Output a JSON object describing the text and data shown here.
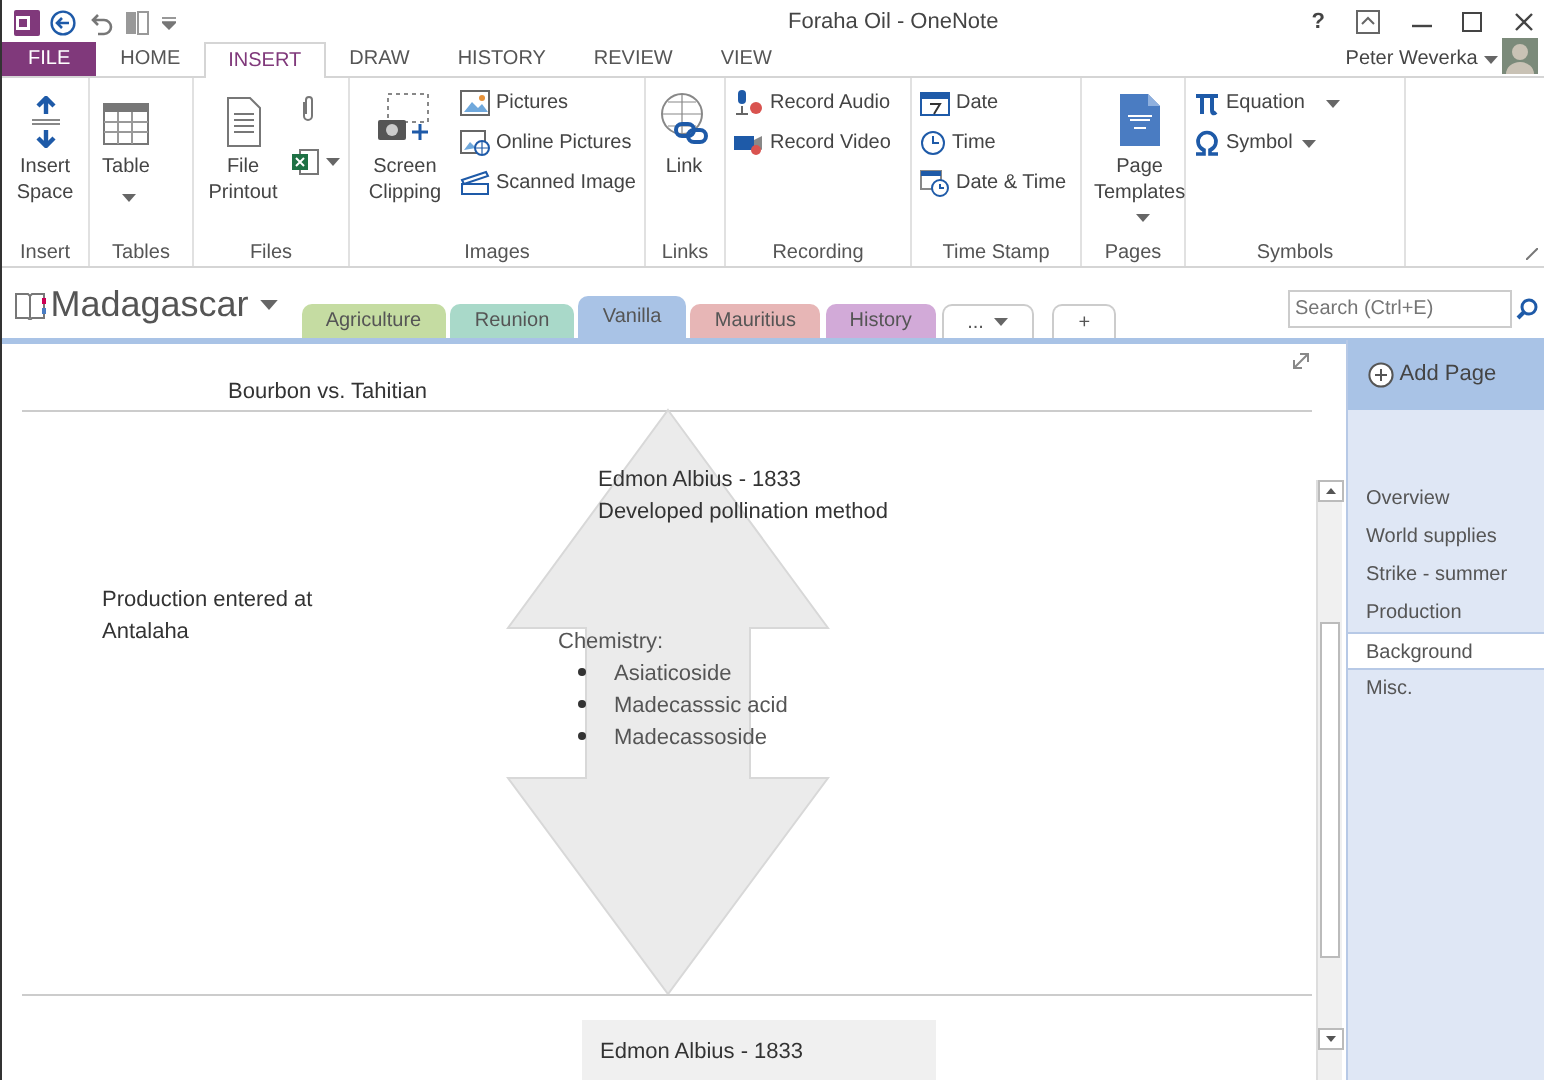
{
  "window": {
    "title": "Foraha Oil - OneNote",
    "help": "?"
  },
  "tabs": [
    {
      "label": "FILE",
      "kind": "file",
      "selected": false
    },
    {
      "label": "HOME",
      "kind": "tab",
      "selected": false
    },
    {
      "label": "INSERT",
      "kind": "tab",
      "selected": true
    },
    {
      "label": "DRAW",
      "kind": "tab",
      "selected": false
    },
    {
      "label": "HISTORY",
      "kind": "tab",
      "selected": false
    },
    {
      "label": "REVIEW",
      "kind": "tab",
      "selected": false
    },
    {
      "label": "VIEW",
      "kind": "tab",
      "selected": false
    }
  ],
  "user": {
    "name": "Peter Weverka"
  },
  "ribbon": [
    {
      "label": "Insert",
      "items": [
        {
          "kind": "large",
          "label": "Insert Space",
          "menu": false
        }
      ]
    },
    {
      "label": "Tables",
      "items": [
        {
          "kind": "large",
          "label": "Table",
          "menu": true
        }
      ]
    },
    {
      "label": "Files",
      "items": [
        {
          "kind": "large",
          "label": "File Printout",
          "menu": false
        },
        {
          "kind": "stack",
          "menu": true
        }
      ]
    },
    {
      "label": "Images",
      "items": [
        {
          "kind": "large",
          "label": "Screen Clipping",
          "menu": false
        },
        {
          "kind": "small",
          "label": "Pictures",
          "menu": false
        },
        {
          "kind": "small",
          "label": "Online Pictures",
          "menu": false
        },
        {
          "kind": "small",
          "label": "Scanned Image",
          "menu": false
        }
      ]
    },
    {
      "label": "Links",
      "items": [
        {
          "kind": "large",
          "label": "Link",
          "menu": false
        }
      ]
    },
    {
      "label": "Recording",
      "items": [
        {
          "kind": "small",
          "label": "Record Audio",
          "menu": false
        },
        {
          "kind": "small",
          "label": "Record Video",
          "menu": false
        }
      ]
    },
    {
      "label": "Time Stamp",
      "items": [
        {
          "kind": "small",
          "label": "Date",
          "menu": false
        },
        {
          "kind": "small",
          "label": "Time",
          "menu": false
        },
        {
          "kind": "small",
          "label": "Date & Time",
          "menu": false
        }
      ]
    },
    {
      "label": "Pages",
      "items": [
        {
          "kind": "large",
          "label": "Page Templates",
          "menu": true
        }
      ]
    },
    {
      "label": "Symbols",
      "items": [
        {
          "kind": "small",
          "label": "Equation",
          "menu": true
        },
        {
          "kind": "small",
          "label": "Symbol",
          "menu": true
        }
      ]
    }
  ],
  "notebook": {
    "name": "Madagascar"
  },
  "sections": [
    {
      "label": "Agriculture",
      "color": "#c5dca2",
      "selected": false
    },
    {
      "label": "Reunion",
      "color": "#a9d9c9",
      "selected": false
    },
    {
      "label": "Vanilla",
      "color": "#a9c3e6",
      "selected": true
    },
    {
      "label": "Mauritius",
      "color": "#e7b6b6",
      "selected": false
    },
    {
      "label": "History",
      "color": "#d2aad8",
      "selected": false
    }
  ],
  "section_overflow": "...",
  "new_section": "+",
  "search": {
    "placeholder": "Search (Ctrl+E)"
  },
  "page": {
    "title": "Bourbon vs. Tahitian",
    "notes": [
      {
        "kind": "text",
        "lines": [
          "Production entered at",
          "Antalaha"
        ]
      },
      {
        "kind": "text",
        "lines": [
          "Edmon Albius - 1833",
          "Developed pollination method"
        ]
      },
      {
        "kind": "list",
        "heading": "Chemistry:",
        "items": [
          "Asiaticoside",
          "Madecasssic acid",
          "Madecassoside"
        ]
      },
      {
        "kind": "boxed",
        "lines": [
          "Edmon Albius - 1833"
        ]
      }
    ]
  },
  "add_page": "Add Page",
  "pages": [
    {
      "label": "Overview",
      "selected": false
    },
    {
      "label": "World supplies",
      "selected": false
    },
    {
      "label": "Strike - summer",
      "selected": false
    },
    {
      "label": "Production",
      "selected": false
    },
    {
      "label": "Background",
      "selected": true
    },
    {
      "label": "Misc.",
      "selected": false
    }
  ]
}
